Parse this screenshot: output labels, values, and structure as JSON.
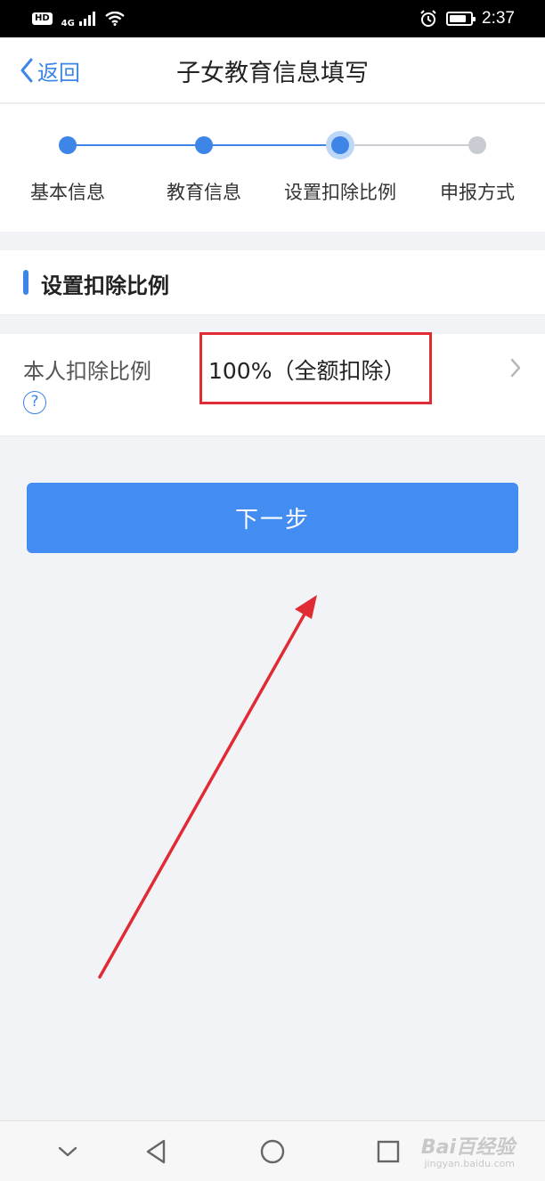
{
  "status_bar": {
    "hd": "HD",
    "network": "4G",
    "time": "2:37",
    "icons": [
      "signal-icon",
      "wifi-icon",
      "alarm-icon",
      "battery-icon"
    ]
  },
  "nav": {
    "back_label": "返回",
    "title": "子女教育信息填写"
  },
  "stepper": {
    "steps": [
      {
        "label": "基本信息",
        "state": "done"
      },
      {
        "label": "教育信息",
        "state": "done"
      },
      {
        "label": "设置扣除比例",
        "state": "current"
      },
      {
        "label": "申报方式",
        "state": "todo"
      }
    ]
  },
  "section": {
    "title": "设置扣除比例"
  },
  "ratio_row": {
    "label": "本人扣除比例",
    "help": "?",
    "value": "100%（全额扣除）"
  },
  "next_button": {
    "label": "下一步"
  },
  "annotations": {
    "highlight_color": "#e02b35",
    "arrow_color": "#e02b35"
  },
  "watermark": {
    "text": "Bai百经验",
    "sub": "jingyan.baidu.com"
  },
  "colors": {
    "accent": "#3d86e8",
    "button": "#428cf2",
    "step_todo": "#c9ccd2"
  }
}
